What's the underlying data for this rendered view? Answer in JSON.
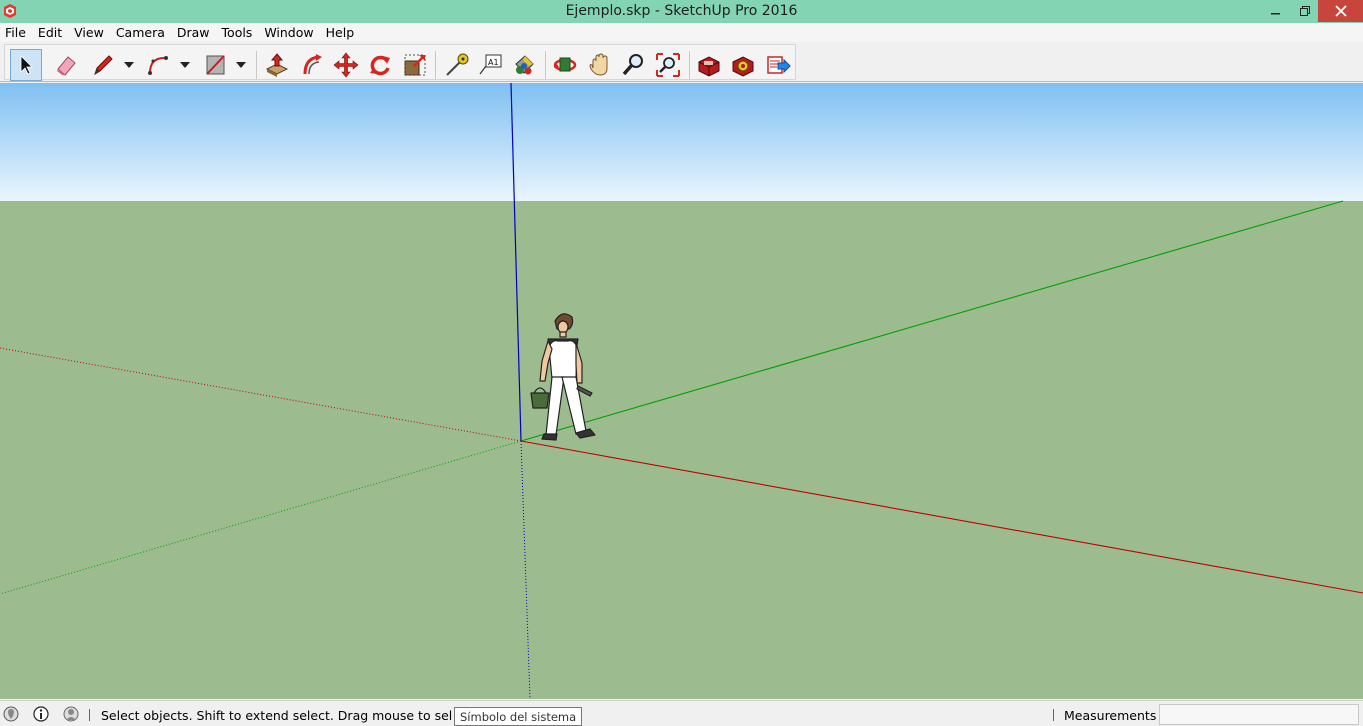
{
  "window": {
    "title": "Ejemplo.skp - SketchUp Pro 2016"
  },
  "menu": [
    "File",
    "Edit",
    "View",
    "Camera",
    "Draw",
    "Tools",
    "Window",
    "Help"
  ],
  "toolbar": {
    "tools": [
      "select",
      "eraser",
      "pencil-line",
      "arc",
      "rectangle",
      "push-pull",
      "offset",
      "move",
      "rotate",
      "scale",
      "tape-measure",
      "text",
      "paint-bucket",
      "orbit",
      "pan",
      "zoom",
      "zoom-extents",
      "3d-warehouse",
      "extension-warehouse",
      "send-to-layout"
    ],
    "active_tool": "select"
  },
  "status": {
    "hint": "Select objects. Shift to extend select. Drag mouse to select multiple.",
    "tooltip": "Símbolo del sistema",
    "measurements_label": "Measurements",
    "measurements_value": ""
  },
  "colors": {
    "titlebar": "#83d4b3",
    "sky": "#85c4f2",
    "ground": "#9cbc8f",
    "axis_red": "#c00000",
    "axis_green": "#00a000",
    "axis_blue": "#0000c0",
    "close_button": "#c7453c"
  }
}
